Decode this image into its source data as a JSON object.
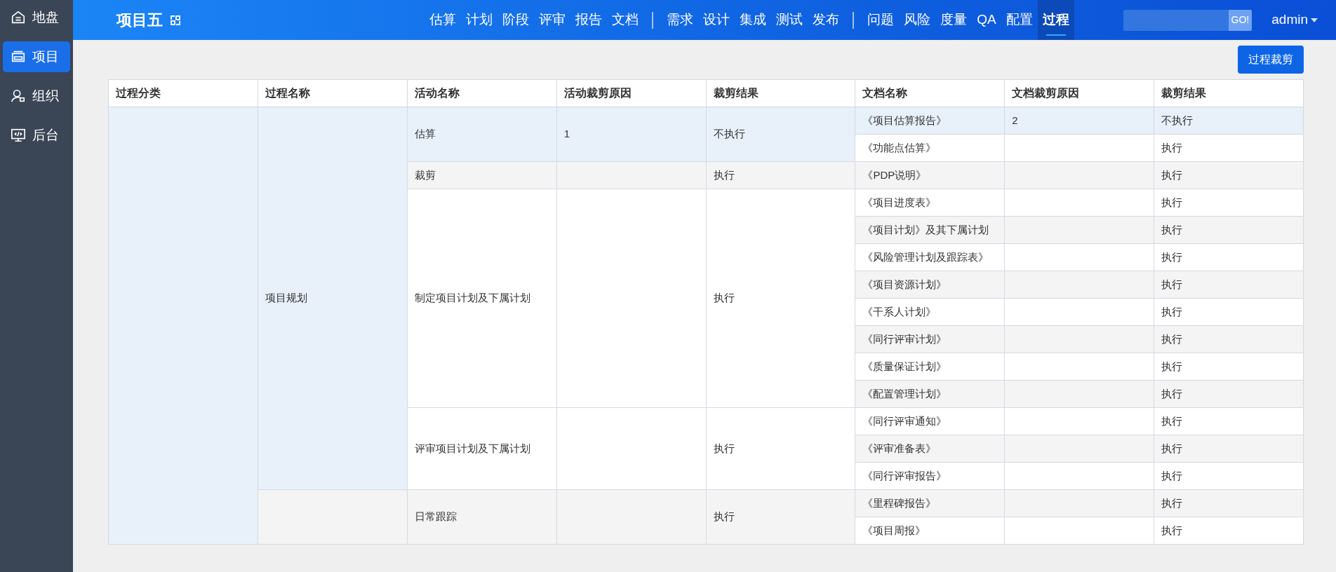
{
  "sidebar": {
    "items": [
      {
        "label": "地盘",
        "kind": "home",
        "selected": false
      },
      {
        "label": "项目",
        "kind": "folder",
        "selected": true
      },
      {
        "label": "组织",
        "kind": "user",
        "selected": false
      },
      {
        "label": "后台",
        "kind": "monitor",
        "selected": false
      }
    ]
  },
  "topbar": {
    "title": "项目五",
    "nav_groups": [
      [
        {
          "label": "估算",
          "selected": false
        },
        {
          "label": "计划",
          "selected": false
        },
        {
          "label": "阶段",
          "selected": false
        },
        {
          "label": "评审",
          "selected": false
        },
        {
          "label": "报告",
          "selected": false
        },
        {
          "label": "文档",
          "selected": false
        }
      ],
      [
        {
          "label": "需求",
          "selected": false
        },
        {
          "label": "设计",
          "selected": false
        },
        {
          "label": "集成",
          "selected": false
        },
        {
          "label": "测试",
          "selected": false
        },
        {
          "label": "发布",
          "selected": false
        }
      ],
      [
        {
          "label": "问题",
          "selected": false
        },
        {
          "label": "风险",
          "selected": false
        },
        {
          "label": "度量",
          "selected": false
        },
        {
          "label": "QA",
          "selected": false
        },
        {
          "label": "配置",
          "selected": false
        },
        {
          "label": "过程",
          "selected": true
        }
      ]
    ],
    "search_button": "GO!",
    "user": "admin"
  },
  "action_button": "过程裁剪",
  "table": {
    "columns": [
      "过程分类",
      "过程名称",
      "活动名称",
      "活动裁剪原因",
      "裁剪结果",
      "文档名称",
      "文档裁剪原因",
      "裁剪结果"
    ],
    "categories": [
      {
        "highlighted": true,
        "processes": [
          {
            "name": "项目规划",
            "highlighted": true,
            "activities": [
              {
                "name": "估算",
                "reason": "1",
                "result": "不执行",
                "highlighted": true,
                "documents": [
                  {
                    "name": "《项目估算报告》",
                    "reason": "2",
                    "result": "不执行",
                    "highlighted": true
                  },
                  {
                    "name": "《功能点估算》",
                    "result": "执行",
                    "highlighted": false
                  }
                ]
              },
              {
                "name": "裁剪",
                "result": "执行",
                "highlighted": false,
                "documents": [
                  {
                    "name": "《PDP说明》",
                    "result": "执行",
                    "highlighted": false
                  }
                ]
              },
              {
                "name": "制定项目计划及下属计划",
                "result": "执行",
                "highlighted": false,
                "documents": [
                  {
                    "name": "《项目进度表》",
                    "result": "执行",
                    "highlighted": false
                  },
                  {
                    "name": "《项目计划》及其下属计划",
                    "result": "执行",
                    "highlighted": false
                  },
                  {
                    "name": "《风险管理计划及跟踪表》",
                    "result": "执行",
                    "highlighted": false
                  },
                  {
                    "name": "《项目资源计划》",
                    "result": "执行",
                    "highlighted": false
                  },
                  {
                    "name": "《干系人计划》",
                    "result": "执行",
                    "highlighted": false
                  },
                  {
                    "name": "《同行评审计划》",
                    "result": "执行",
                    "highlighted": false
                  },
                  {
                    "name": "《质量保证计划》",
                    "result": "执行",
                    "highlighted": false
                  },
                  {
                    "name": "《配置管理计划》",
                    "result": "执行",
                    "highlighted": false
                  }
                ]
              },
              {
                "name": "评审项目计划及下属计划",
                "result": "执行",
                "highlighted": false,
                "documents": [
                  {
                    "name": "《同行评审通知》",
                    "result": "执行",
                    "highlighted": false
                  },
                  {
                    "name": "《评审准备表》",
                    "result": "执行",
                    "highlighted": false
                  },
                  {
                    "name": "《同行评审报告》",
                    "result": "执行",
                    "highlighted": false
                  }
                ]
              }
            ]
          },
          {
            "highlighted": false,
            "activities": [
              {
                "name": "日常跟踪",
                "result": "执行",
                "highlighted": false,
                "documents": [
                  {
                    "name": "《里程碑报告》",
                    "result": "执行",
                    "highlighted": false
                  },
                  {
                    "name": "《项目周报》",
                    "result": "执行",
                    "highlighted": false
                  }
                ]
              }
            ]
          }
        ]
      }
    ]
  }
}
